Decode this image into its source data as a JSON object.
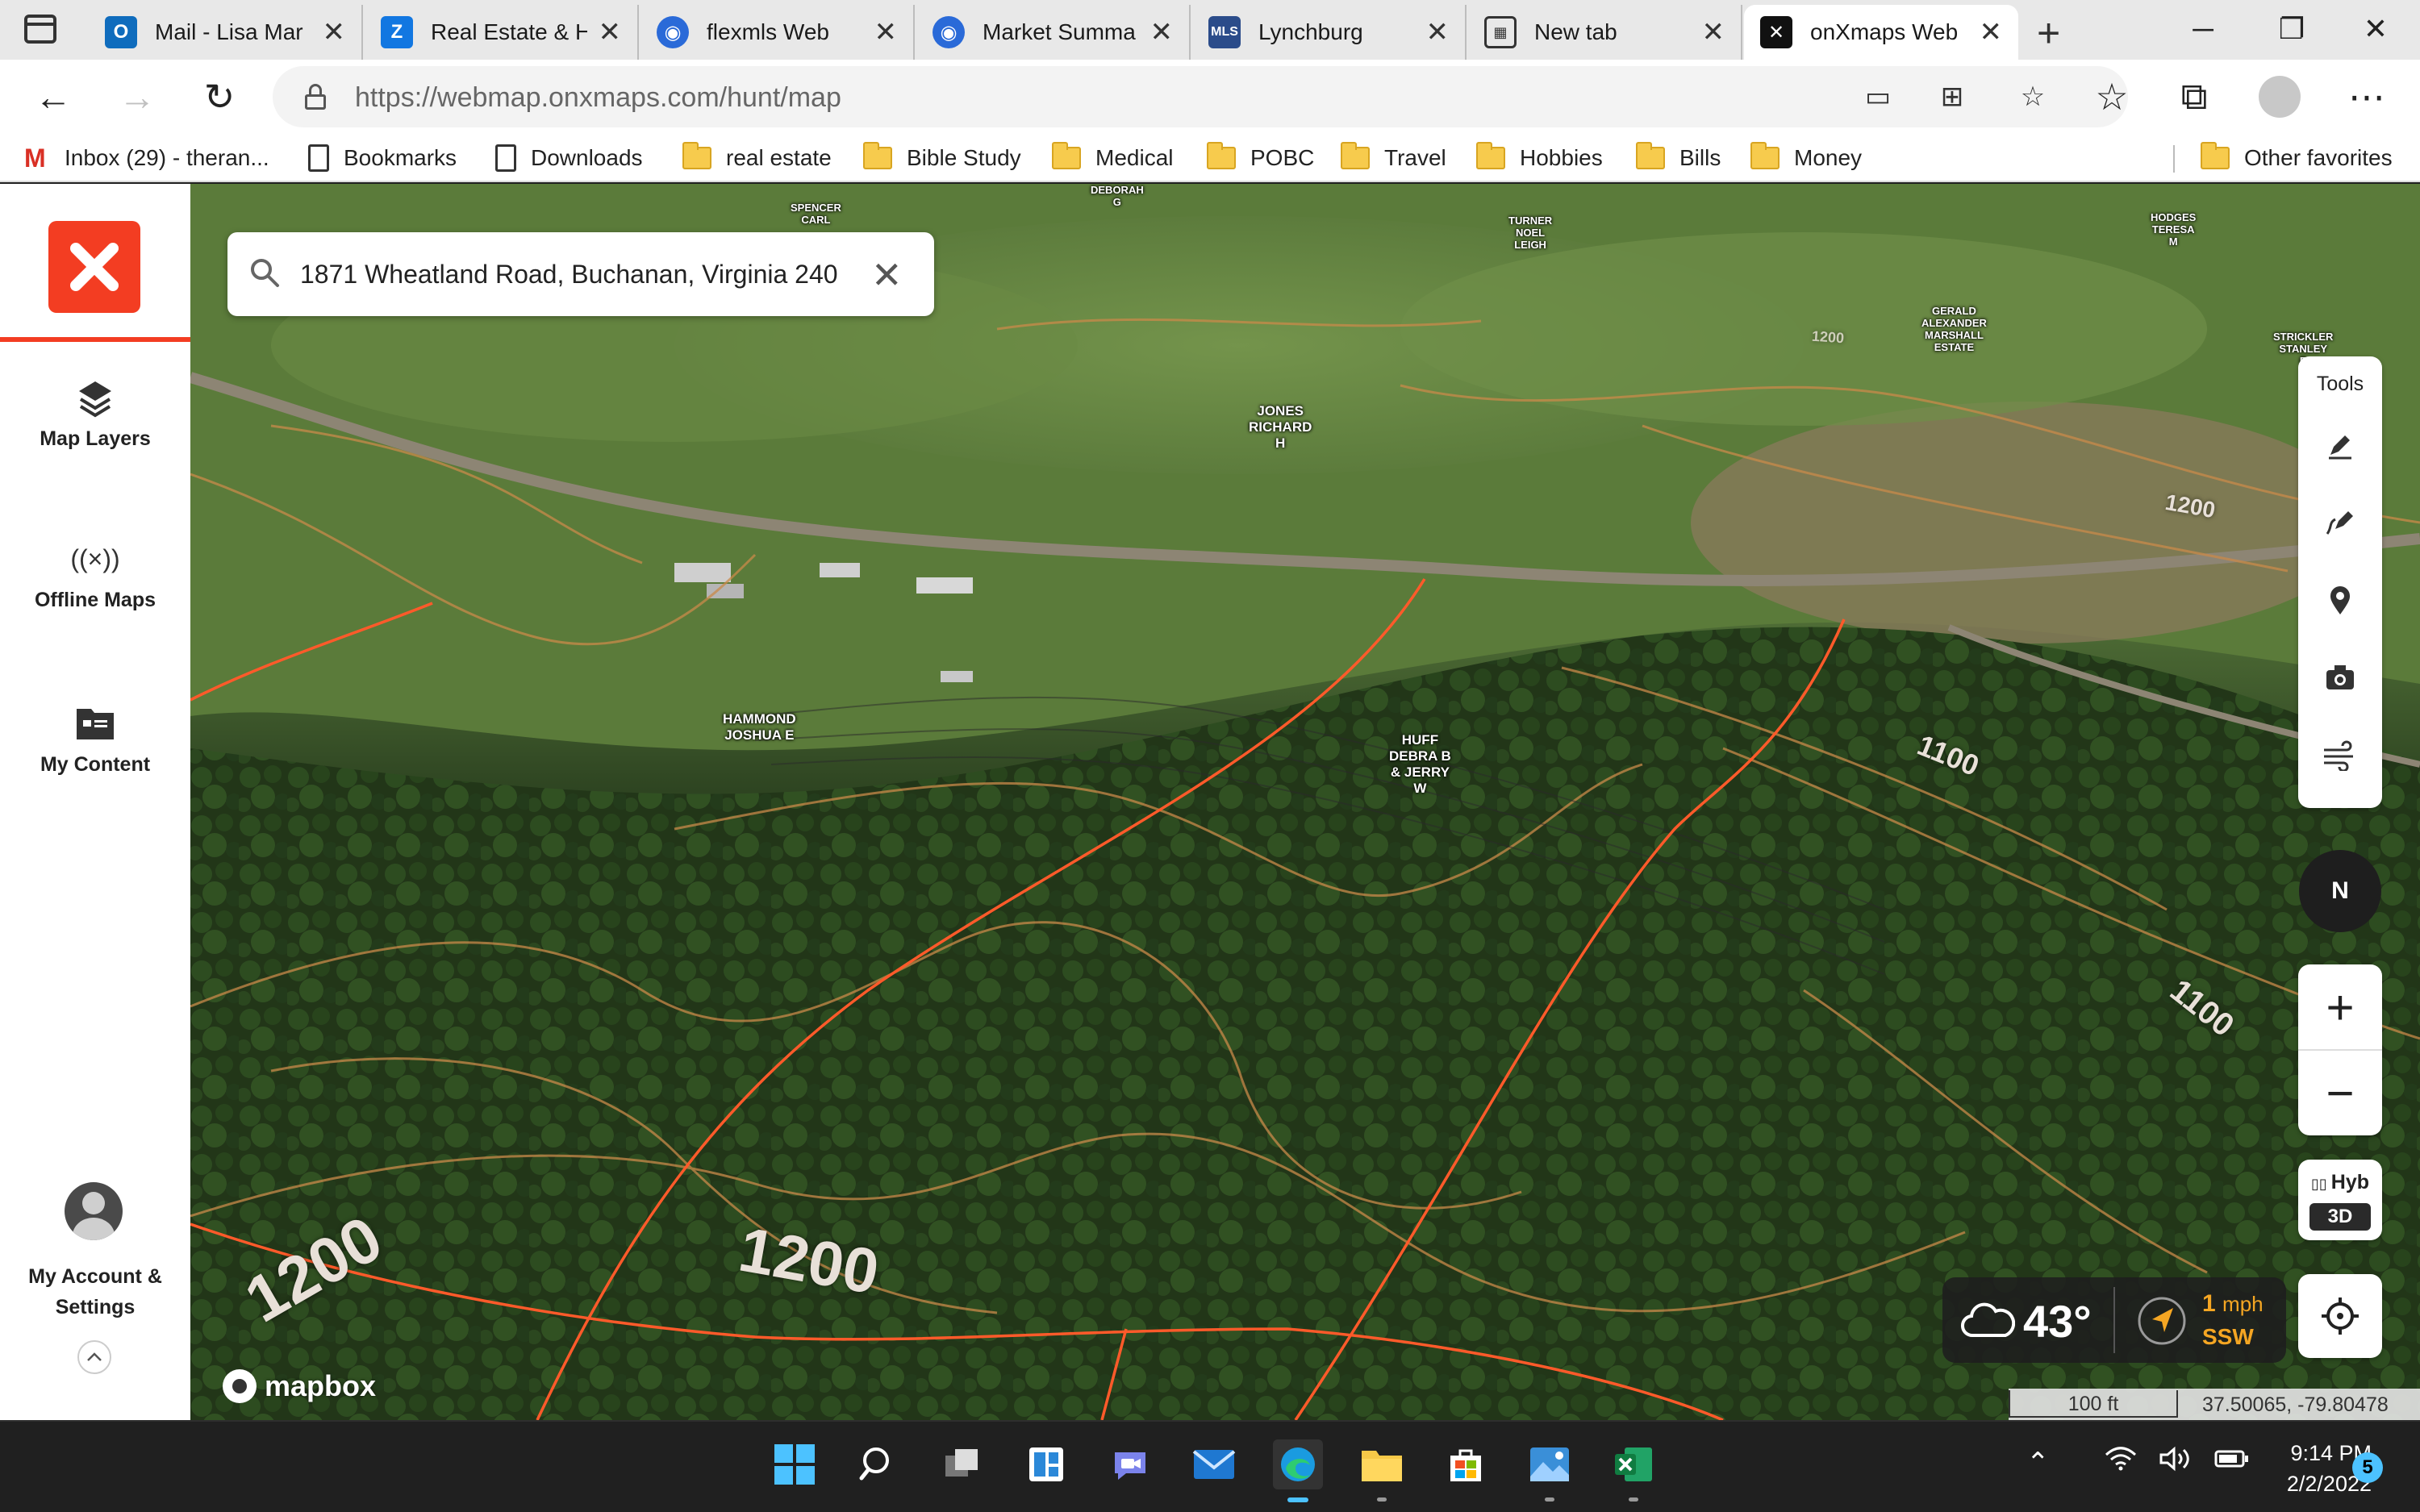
{
  "browser": {
    "tabs": [
      {
        "title": "Mail - Lisa Mar",
        "icon": "outlook-icon",
        "color": "#0f6cbd"
      },
      {
        "title": "Real Estate & H",
        "icon": "zillow-icon",
        "color": "#1277e1"
      },
      {
        "title": "flexmls Web",
        "icon": "flexmls-icon",
        "color": "#2a6ad8"
      },
      {
        "title": "Market Summa",
        "icon": "flexmls-icon",
        "color": "#2a6ad8"
      },
      {
        "title": "Lynchburg",
        "icon": "mls-icon",
        "color": "#2b4c8a"
      },
      {
        "title": "New tab",
        "icon": "new-tab-icon",
        "color": "#333333"
      },
      {
        "title": "onXmaps Web",
        "icon": "onx-icon",
        "color": "#111111"
      }
    ],
    "url_host": "https://webmap.onxmaps.com",
    "url_path": "/hunt/map",
    "bookmarks": [
      {
        "label": "Inbox (29) - theran...",
        "type": "gmail"
      },
      {
        "label": "Bookmarks",
        "type": "page"
      },
      {
        "label": "Downloads",
        "type": "page"
      },
      {
        "label": "real estate",
        "type": "folder"
      },
      {
        "label": "Bible Study",
        "type": "folder"
      },
      {
        "label": "Medical",
        "type": "folder"
      },
      {
        "label": "POBC",
        "type": "folder"
      },
      {
        "label": "Travel",
        "type": "folder"
      },
      {
        "label": "Hobbies",
        "type": "folder"
      },
      {
        "label": "Bills",
        "type": "folder"
      },
      {
        "label": "Money",
        "type": "folder"
      }
    ],
    "other_favorites": "Other favorites"
  },
  "sidebar": {
    "items": [
      {
        "label": "Map Layers",
        "icon": "layers-icon"
      },
      {
        "label": "Offline Maps",
        "icon": "broadcast-icon"
      },
      {
        "label": "My Content",
        "icon": "folder-card-icon"
      }
    ],
    "account_line1": "My Account &",
    "account_line2": "Settings"
  },
  "map": {
    "search_value": "1871 Wheatland Road, Buchanan, Virginia 240",
    "tools_title": "Tools",
    "parcels": [
      {
        "text": "SPENCER\nCARL"
      },
      {
        "text": "DEBORAH\nG"
      },
      {
        "text": "TURNER\nNOEL\nLEIGH"
      },
      {
        "text": "HODGES\nTERESA\nM"
      },
      {
        "text": "GERALD\nALEXANDER\nMARSHALL\nESTATE"
      },
      {
        "text": "STRICKLER\nSTANLEY\nE"
      },
      {
        "text": "JONES\nRICHARD\nH"
      },
      {
        "text": "HAMMOND\nJOSHUA E"
      },
      {
        "text": "HUFF\nDEBRA B\n& JERRY\nW"
      }
    ],
    "contours": [
      {
        "text": "1200"
      },
      {
        "text": "1200"
      },
      {
        "text": "1100"
      },
      {
        "text": "1100"
      },
      {
        "text": "1200"
      },
      {
        "text": "1200"
      }
    ],
    "compass": "N",
    "basemap": "Hyb",
    "mode": "3D",
    "weather": {
      "temp": "43°",
      "wind_speed": "1",
      "wind_unit": "mph",
      "wind_dir": "SSW"
    },
    "attribution": "mapbox",
    "scale": "100 ft",
    "coordinates": "37.50065, -79.80478"
  },
  "taskbar": {
    "time": "9:14 PM",
    "date": "2/2/2022",
    "notifications": "5"
  }
}
